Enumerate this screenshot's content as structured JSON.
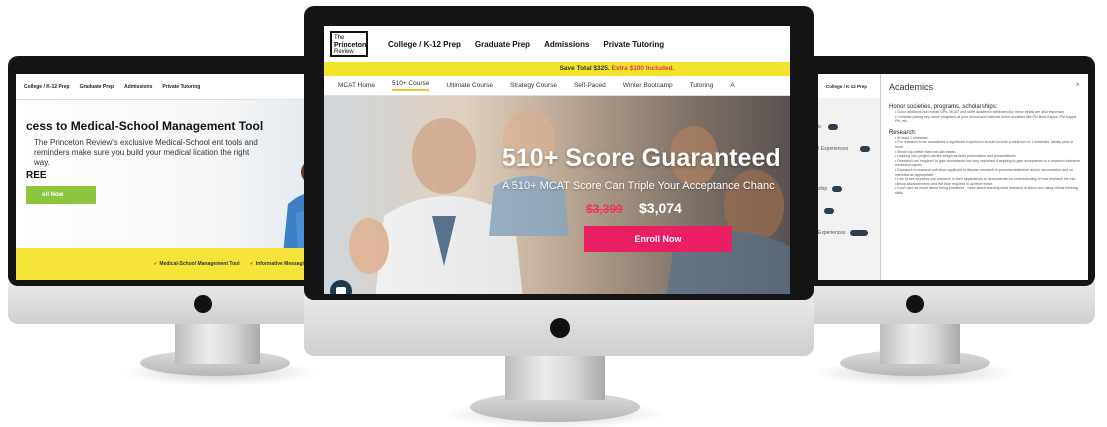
{
  "left_screen": {
    "nav": [
      "College / K-12 Prep",
      "Graduate Prep",
      "Admissions",
      "Private Tutoring"
    ],
    "title": "cess to Medical-School Management Tool",
    "desc": "The Princeton Review's exclusive Medical-School ent tools and reminders make sure you build your medical lication the right way.",
    "free": "REE",
    "cta": "oll Now",
    "features": [
      "Medical-School Management Tool",
      "Informative Messaging"
    ]
  },
  "center_screen": {
    "logo": {
      "line1": "The",
      "line2": "Princeton",
      "line3": "Review"
    },
    "menu": [
      "College / K-12 Prep",
      "Graduate Prep",
      "Admissions",
      "Private Tutoring"
    ],
    "promo": {
      "text": "Save Total $325.",
      "highlight": "Extra $100 Included."
    },
    "tabs": [
      "MCAT Home",
      "510+ Course",
      "Ultimate Course",
      "Strategy Course",
      "Self-Paced",
      "Winter Bootcamp",
      "Tutoring",
      "A"
    ],
    "active_tab": "510+ Course",
    "headline": "510+ Score Guaranteed",
    "subline": "A 510+ MCAT Score Can Triple Your Acceptance Chanc",
    "old_price": "$3,399",
    "new_price": "$3,074",
    "cta": "Enroll Now"
  },
  "right_screen": {
    "nav": "College / K-12 Prep",
    "rows": [
      "ic",
      "I Experiences",
      "ship",
      "",
      "Experiences"
    ],
    "panel_title": "Academics",
    "close": "×",
    "section1_title": "Honor societies, programs, scholarships:",
    "section1_items": [
      "Good additions but overall GPA, MCAT and other academic attributes like these below are also important",
      "Consider joining key honor programs at your school and national honor societies like Phi Beta Kappa, Phi Kappa Phi, etc."
    ],
    "section2_title": "Research:",
    "section2_items": [
      "At least 1 semester",
      "For research to be considered a significant experience should include a minimum of 1 semester, ideally year or more",
      "Bench top better than non-lab based",
      "Leading own project carries weight as does publications and presentations",
      "Research not 'required' to gain acceptance but very important if aspiring to gain acceptance to a research intensive medical program",
      "Exposure to research will allow applicant to discuss research in personal statement and/or secondaries and on interview as appropriate",
      "Like to see students use research in their applications to demonstrate an understanding of how research fits into clinical advancements and the time required to achieve these",
      "Don't care as much about being published - more about learning what research is about and using critical thinking skills"
    ]
  },
  "colors": {
    "bezel": "#141414",
    "promo_yellow": "#f2e32c",
    "enroll_pink": "#e91e63",
    "left_cta_green": "#8cc63f",
    "old_price_red": "#e8365d"
  }
}
